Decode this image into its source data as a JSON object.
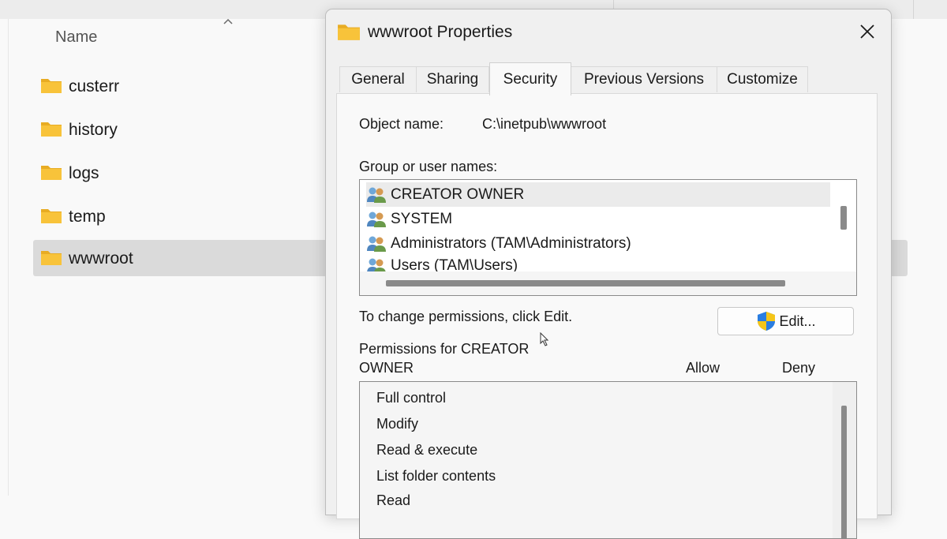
{
  "explorer": {
    "column_header": "Name",
    "files": [
      {
        "name": "custerr",
        "selected": false
      },
      {
        "name": "history",
        "selected": false
      },
      {
        "name": "logs",
        "selected": false
      },
      {
        "name": "temp",
        "selected": false
      },
      {
        "name": "wwwroot",
        "selected": true
      }
    ]
  },
  "dialog": {
    "title": "wwwroot Properties",
    "tabs": [
      {
        "label": "General",
        "active": false
      },
      {
        "label": "Sharing",
        "active": false
      },
      {
        "label": "Security",
        "active": true
      },
      {
        "label": "Previous Versions",
        "active": false
      },
      {
        "label": "Customize",
        "active": false
      }
    ],
    "object_name_label": "Object name:",
    "object_name_value": "C:\\inetpub\\wwwroot",
    "group_label": "Group or user names:",
    "users": [
      {
        "name": "CREATOR OWNER",
        "selected": true
      },
      {
        "name": "SYSTEM",
        "selected": false
      },
      {
        "name": "Administrators (TAM\\Administrators)",
        "selected": false
      },
      {
        "name": "Users (TAM\\Users)",
        "selected": false
      }
    ],
    "change_hint": "To change permissions, click Edit.",
    "edit_button": "Edit...",
    "permissions_for_line1": "Permissions for CREATOR",
    "permissions_for_line2": "OWNER",
    "allow_header": "Allow",
    "deny_header": "Deny",
    "permissions": [
      "Full control",
      "Modify",
      "Read & execute",
      "List folder contents",
      "Read"
    ]
  },
  "colors": {
    "folder_yellow": "#f8c33a",
    "shield_blue": "#2a7de1",
    "shield_yellow": "#f5c518"
  }
}
